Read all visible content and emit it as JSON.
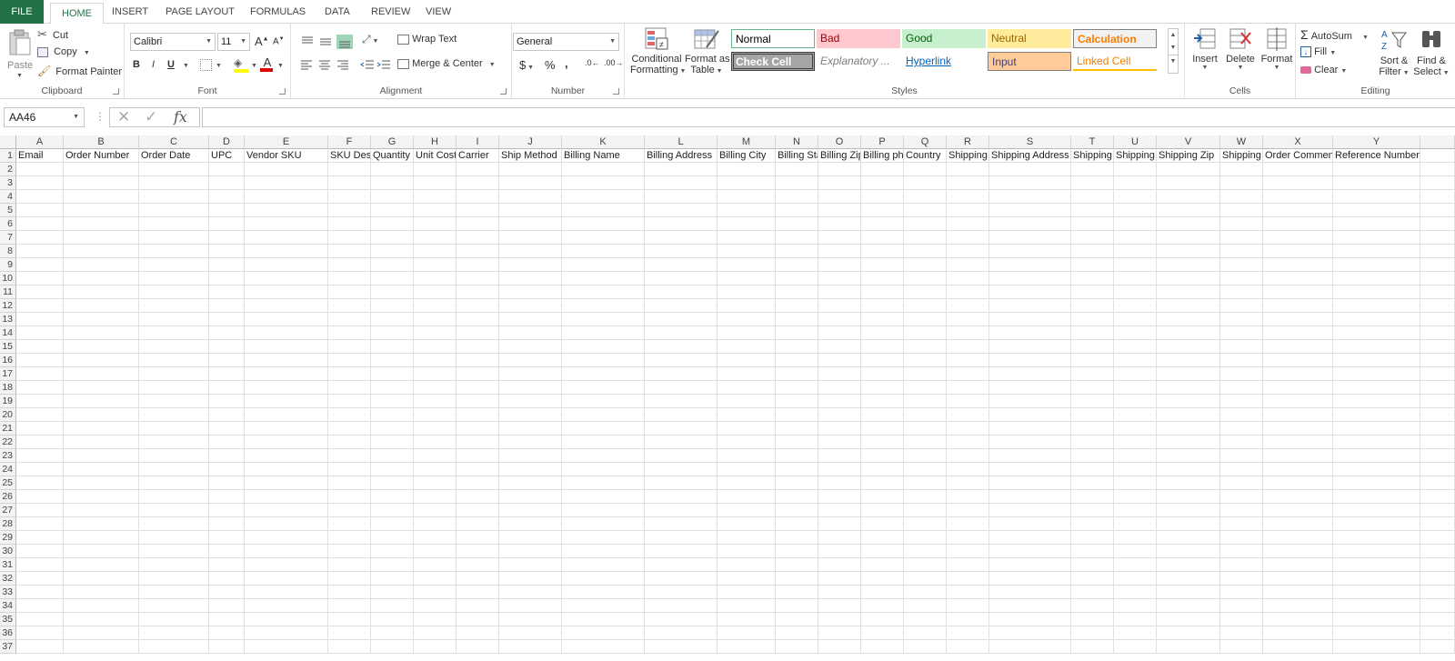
{
  "tabs": {
    "file": "FILE",
    "home": "HOME",
    "insert": "INSERT",
    "page_layout": "PAGE LAYOUT",
    "formulas": "FORMULAS",
    "data": "DATA",
    "review": "REVIEW",
    "view": "VIEW"
  },
  "clipboard": {
    "paste": "Paste",
    "cut": "Cut",
    "copy": "Copy",
    "format_painter": "Format Painter",
    "label": "Clipboard"
  },
  "font": {
    "name": "Calibri",
    "size": "11",
    "bold": "B",
    "italic": "I",
    "underline": "U",
    "label": "Font"
  },
  "alignment": {
    "wrap_text": "Wrap Text",
    "merge_center": "Merge & Center",
    "label": "Alignment"
  },
  "number": {
    "format": "General",
    "currency": "$",
    "percent": "%",
    "comma": ",",
    "label": "Number"
  },
  "styles": {
    "conditional_formatting": [
      "Conditional",
      "Formatting"
    ],
    "format_as_table": [
      "Format as",
      "Table"
    ],
    "gallery": [
      {
        "name": "Normal",
        "bg": "#ffffff",
        "fg": "#000000",
        "border": "#66b48a"
      },
      {
        "name": "Bad",
        "bg": "#ffc7ce",
        "fg": "#9c0006",
        "border": "none"
      },
      {
        "name": "Good",
        "bg": "#c6efce",
        "fg": "#006100",
        "border": "none"
      },
      {
        "name": "Neutral",
        "bg": "#ffeb9c",
        "fg": "#9c6500",
        "border": "none"
      },
      {
        "name": "Calculation",
        "bg": "#f2f2f2",
        "fg": "#fa7d00",
        "border": "#7f7f7f"
      },
      {
        "name": "Check Cell",
        "bg": "#a5a5a5",
        "fg": "#ffffff",
        "border": "#3f3f3f"
      },
      {
        "name": "Explanatory ...",
        "bg": "#ffffff",
        "fg": "#7f7f7f",
        "border": "none"
      },
      {
        "name": "Hyperlink",
        "bg": "#ffffff",
        "fg": "#0563c1",
        "border": "none"
      },
      {
        "name": "Input",
        "bg": "#ffcc99",
        "fg": "#3f3f76",
        "border": "#7f7f7f"
      },
      {
        "name": "Linked Cell",
        "bg": "#ffffff",
        "fg": "#fa7d00",
        "border": "none"
      }
    ],
    "label": "Styles"
  },
  "cells": {
    "insert": "Insert",
    "delete": "Delete",
    "format": "Format",
    "label": "Cells"
  },
  "editing": {
    "autosum": "AutoSum",
    "fill": "Fill",
    "clear": "Clear",
    "sort_filter": [
      "Sort &",
      "Filter"
    ],
    "find_select": [
      "Find &",
      "Select"
    ],
    "label": "Editing"
  },
  "formula_bar": {
    "name_box": "AA46",
    "fx": "fx",
    "formula": ""
  },
  "sheet": {
    "columns": [
      "A",
      "B",
      "C",
      "D",
      "E",
      "F",
      "G",
      "H",
      "I",
      "J",
      "K",
      "L",
      "M",
      "N",
      "O",
      "P",
      "Q",
      "R",
      "S",
      "T",
      "U",
      "V",
      "W",
      "X",
      "Y"
    ],
    "header_row": [
      "Email",
      "Order Number",
      "Order Date",
      "UPC",
      "Vendor SKU",
      "SKU Description",
      "Quantity",
      "Unit Cost",
      "Carrier",
      "Ship Method",
      "Billing Name",
      "Billing Address",
      "Billing City",
      "Billing State",
      "Billing Zip",
      "Billing phone",
      "Country",
      "Shipping",
      "Shipping Address",
      "Shipping",
      "Shipping",
      "Shipping Zip",
      "Shipping",
      "Order Comment",
      "Reference Number"
    ],
    "row_count": 37
  },
  "colors": {
    "accent": "#217346",
    "gridline": "#e0e0e0",
    "header_bg": "#f3f3f3"
  }
}
